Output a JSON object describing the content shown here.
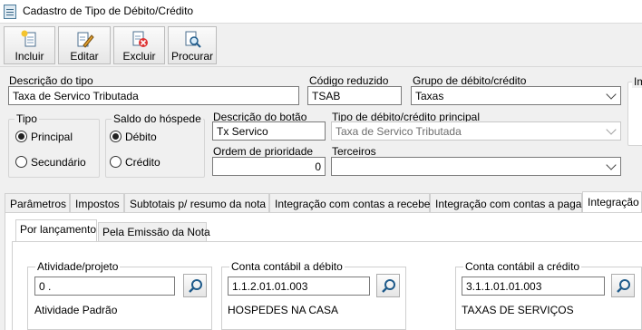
{
  "window": {
    "title": "Cadastro de Tipo de Débito/Crédito"
  },
  "toolbar": {
    "incluir": "Incluir",
    "editar": "Editar",
    "excluir": "Excluir",
    "procurar": "Procurar"
  },
  "form": {
    "descricao_tipo": {
      "label": "Descrição do tipo",
      "value": "Taxa de Servico Tributada"
    },
    "codigo_reduzido": {
      "label": "Código reduzido",
      "value": "TSAB"
    },
    "grupo": {
      "label": "Grupo de débito/crédito",
      "value": "Taxas"
    },
    "cut_label": "Im",
    "tipo": {
      "label": "Tipo",
      "options": [
        "Principal",
        "Secundário"
      ],
      "selected": "Principal"
    },
    "saldo": {
      "label": "Saldo do hóspede",
      "options": [
        "Débito",
        "Crédito"
      ],
      "selected": "Débito"
    },
    "descricao_botao": {
      "label": "Descrição do botão",
      "value": "Tx Servico"
    },
    "tipo_principal": {
      "label": "Tipo de débito/crédito principal",
      "value": "Taxa de Servico Tributada"
    },
    "ordem_prioridade": {
      "label": "Ordem de prioridade",
      "value": "0"
    },
    "terceiros": {
      "label": "Terceiros",
      "value": ""
    }
  },
  "tabs": [
    "Parâmetros",
    "Impostos",
    "Subtotais p/ resumo da nota",
    "Integração com contas a receber",
    "Integração com contas a pagar",
    "Integração"
  ],
  "active_tab": "Integração",
  "subtabs": [
    "Por lançamento",
    "Pela Emissão da Nota"
  ],
  "active_subtab": "Por lançamento",
  "lookups": {
    "atividade": {
      "label": "Atividade/projeto",
      "value": "0 .",
      "description": "Atividade Padrão"
    },
    "debito": {
      "label": "Conta contábil a débito",
      "value": "1.1.2.01.01.003",
      "description": "HOSPEDES NA CASA"
    },
    "credito": {
      "label": "Conta contábil a crédito",
      "value": "3.1.1.01.01.003",
      "description": "TAXAS DE SERVIÇOS"
    }
  },
  "colors": {
    "window_bg": "#f0f0f0",
    "border": "#7a7a7a",
    "page_bg": "#ffffff"
  }
}
